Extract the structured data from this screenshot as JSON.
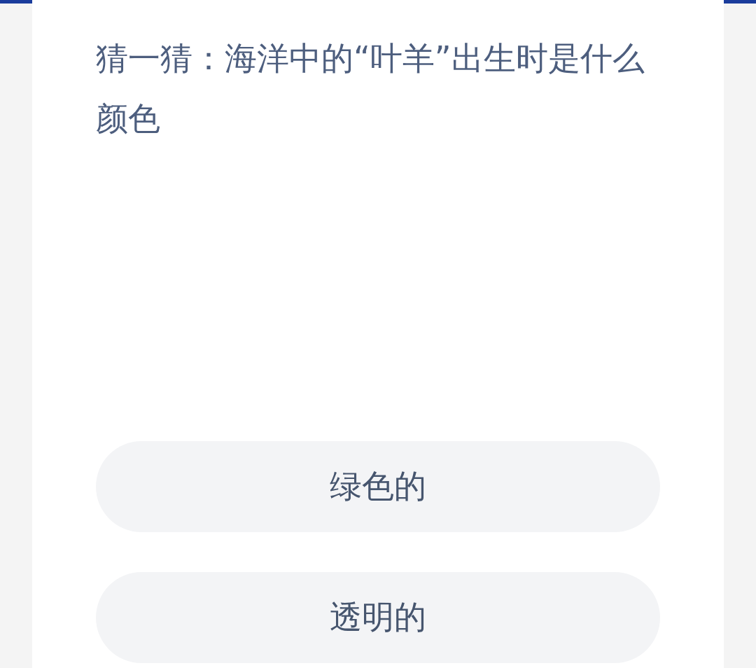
{
  "question": "猜一猜：海洋中的“叶羊”出生时是什么颜色",
  "options": [
    {
      "label": "绿色的"
    },
    {
      "label": "透明的"
    }
  ]
}
